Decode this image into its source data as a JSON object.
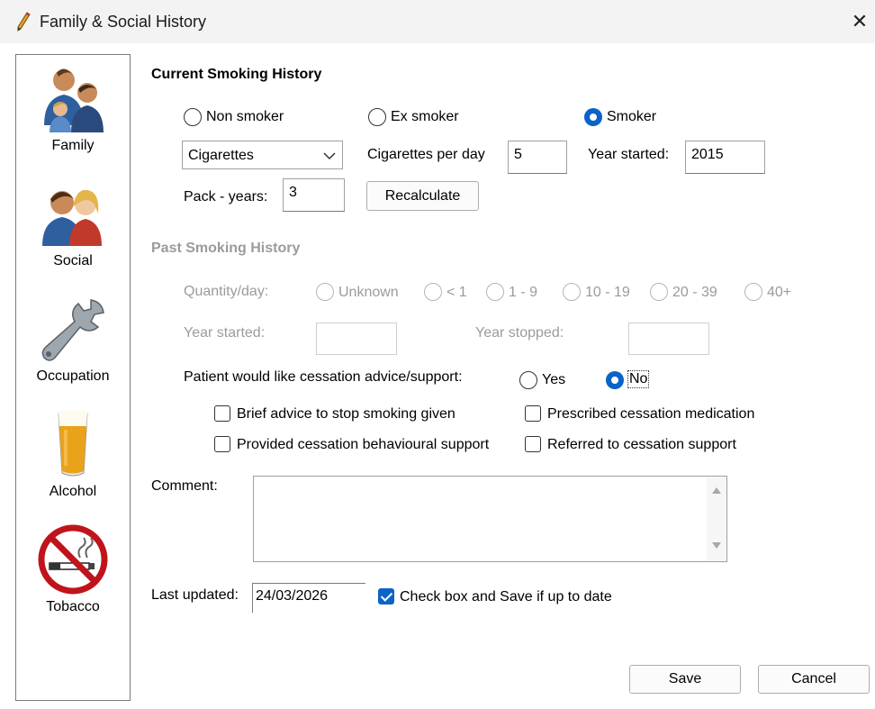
{
  "window": {
    "title": "Family & Social History",
    "close_glyph": "✕"
  },
  "sidebar": {
    "items": [
      {
        "label": "Family",
        "icon": "family-icon"
      },
      {
        "label": "Social",
        "icon": "social-icon"
      },
      {
        "label": "Occupation",
        "icon": "wrench-icon"
      },
      {
        "label": "Alcohol",
        "icon": "beer-glass-icon"
      },
      {
        "label": "Tobacco",
        "icon": "no-smoking-icon"
      }
    ]
  },
  "current": {
    "heading": "Current Smoking History",
    "status_options": [
      "Non smoker",
      "Ex smoker",
      "Smoker"
    ],
    "status_selected": "Smoker",
    "product_value": "Cigarettes",
    "per_day_label": "Cigarettes per day",
    "per_day_value": "5",
    "year_started_label": "Year started:",
    "year_started_value": "2015",
    "pack_years_label": "Pack - years:",
    "pack_years_value": "3",
    "recalculate_label": "Recalculate"
  },
  "past": {
    "heading": "Past Smoking History",
    "quantity_label": "Quantity/day:",
    "quantity_options": [
      "Unknown",
      "< 1",
      "1 - 9",
      "10 - 19",
      "20 - 39",
      "40+"
    ],
    "year_started_label": "Year started:",
    "year_stopped_label": "Year stopped:"
  },
  "cessation": {
    "question": "Patient would like cessation advice/support:",
    "yes_label": "Yes",
    "no_label": "No",
    "selected": "No",
    "checks": [
      {
        "label": "Brief advice to stop smoking given",
        "checked": false
      },
      {
        "label": "Prescribed cessation medication",
        "checked": false
      },
      {
        "label": "Provided cessation behavioural support",
        "checked": false
      },
      {
        "label": "Referred to cessation support",
        "checked": false
      }
    ]
  },
  "comment": {
    "label": "Comment:",
    "value": ""
  },
  "last_updated": {
    "label": "Last updated:",
    "value": "24/03/2026",
    "confirm_label": "Check box and Save if up to date",
    "confirm_checked": true
  },
  "footer": {
    "save_label": "Save",
    "cancel_label": "Cancel"
  },
  "colors": {
    "accent": "#0a63c8",
    "disabled_text": "#9b9b9b"
  }
}
